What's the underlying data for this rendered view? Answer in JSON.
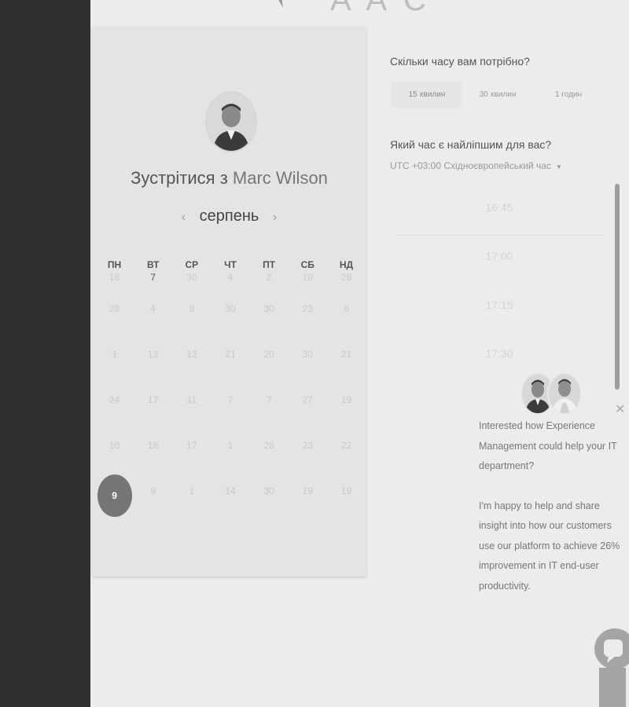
{
  "logo": {
    "text": "A A C"
  },
  "meeting": {
    "title_prefix": "Зустрітися з",
    "host_name": "Marc Wilson"
  },
  "calendar": {
    "month": "серпень",
    "prev_icon": "chevron-left-icon",
    "next_icon": "chevron-right-icon",
    "weekdays": [
      "ПН",
      "ВТ",
      "СР",
      "ЧТ",
      "ПТ",
      "СБ",
      "НД"
    ],
    "weeks": [
      [
        "18",
        "7",
        "30",
        "4",
        "2",
        "10",
        "28"
      ],
      [
        "28",
        "4",
        "8",
        "30",
        "30",
        "23",
        "8"
      ],
      [
        "1",
        "13",
        "13",
        "21",
        "20",
        "30",
        "21"
      ],
      [
        "24",
        "17",
        "11",
        "7",
        "7",
        "27",
        "19"
      ],
      [
        "10",
        "18",
        "17",
        "1",
        "28",
        "23",
        "22"
      ],
      [
        "9",
        "9",
        "1",
        "14",
        "30",
        "19",
        "19"
      ]
    ],
    "selected_day": "9"
  },
  "duration": {
    "question": "Скільки часу вам потрібно?",
    "options": [
      "15 хвилин",
      "30 хвилин",
      "1 годин"
    ],
    "selected": "15 хвилин"
  },
  "time": {
    "question": "Який час є найліпшим для вас?",
    "timezone": "UTC +03:00 Східноєвропейський час",
    "slots": [
      "16:45",
      "17:00",
      "17:15",
      "17:30"
    ]
  },
  "chat": {
    "message_1": "Interested how Experience Management could help your IT department?",
    "message_2": "I'm happy to help and share insight into how our customers use our platform to achieve 26% improvement in IT end-user productivity.",
    "close_icon": "close-icon",
    "launcher_icon": "chat-bubble-icon"
  },
  "colors": {
    "sidebar": "#2f2f2f",
    "background": "#ececec",
    "selected_day": "#757575"
  }
}
